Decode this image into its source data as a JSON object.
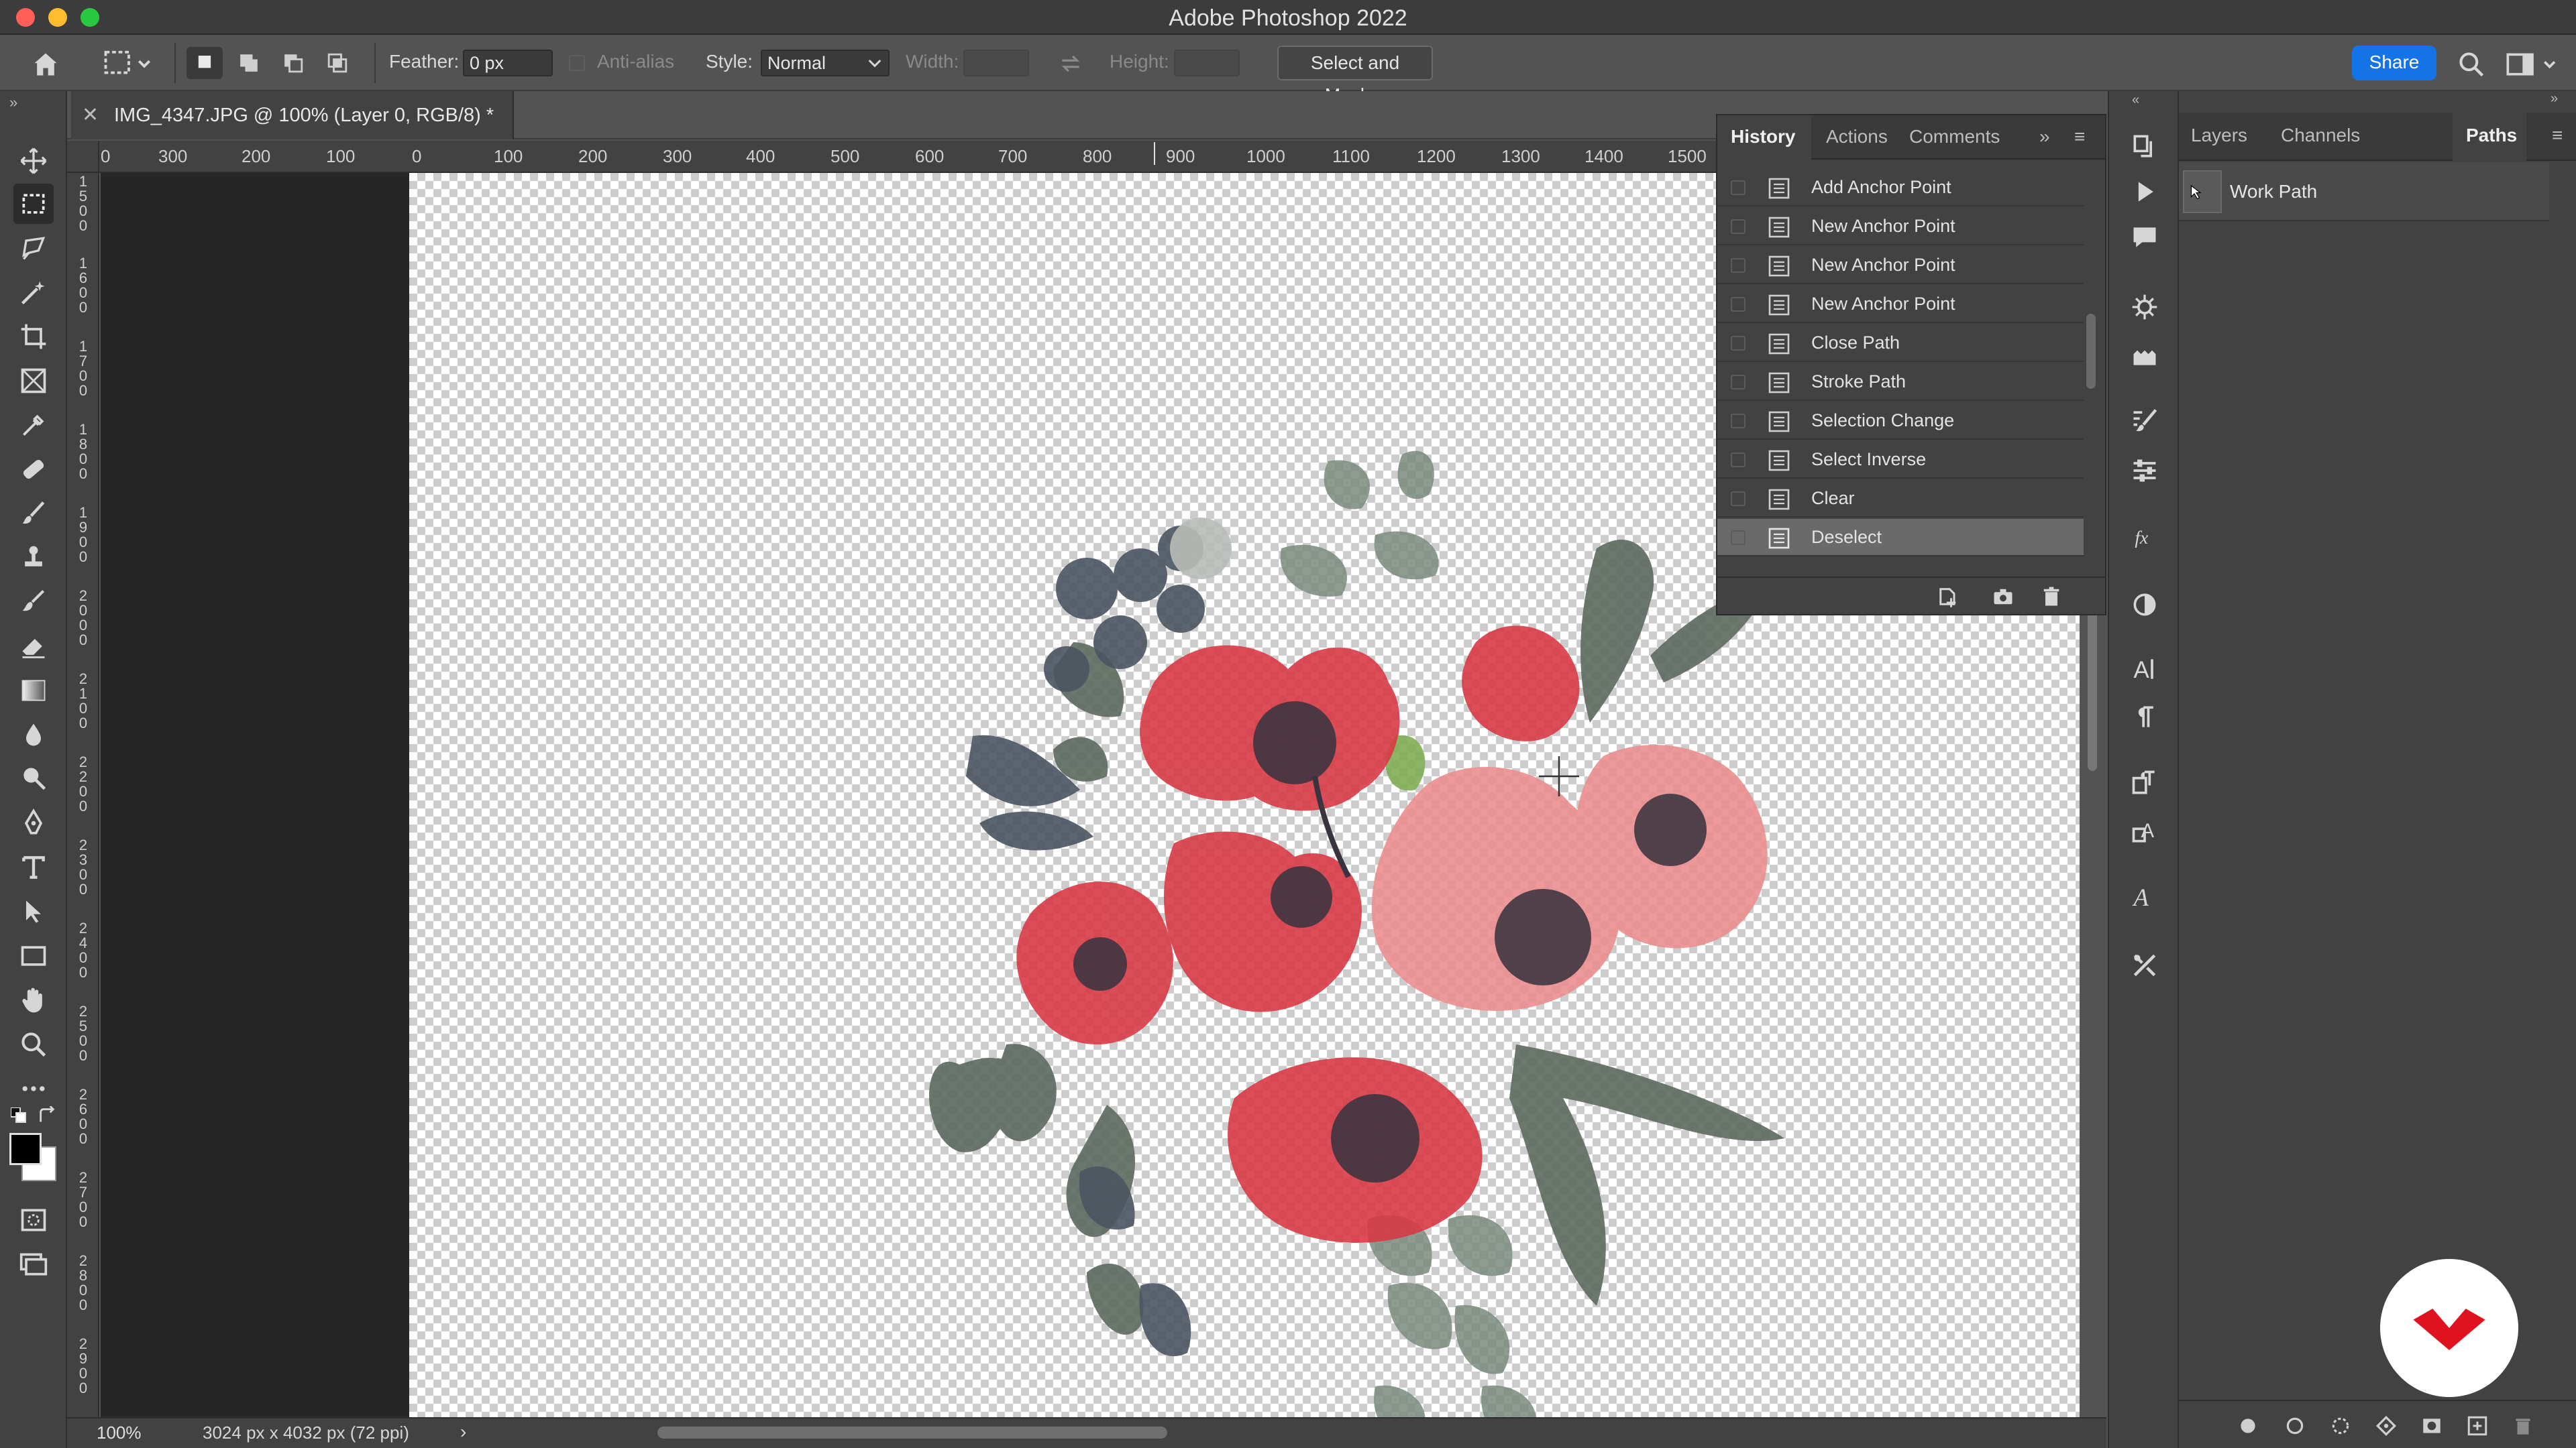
{
  "window": {
    "title": "Adobe Photoshop 2022",
    "traffic_lights": [
      "#ff5f57",
      "#febc2e",
      "#28c840"
    ]
  },
  "options_bar": {
    "feather_label": "Feather:",
    "feather_value": "0 px",
    "anti_alias_label": "Anti-alias",
    "style_label": "Style:",
    "style_value": "Normal",
    "width_label": "Width:",
    "height_label": "Height:",
    "select_mask_label": "Select and Mask...",
    "share_label": "Share"
  },
  "document": {
    "tab_title": "IMG_4347.JPG @ 100% (Layer 0, RGB/8) *",
    "zoom": "100%",
    "doc_info": "3024 px x 4032 px (72 ppi)",
    "h_ruler_labels": [
      "0",
      "300",
      "200",
      "100",
      "0",
      "100",
      "200",
      "300",
      "400",
      "500",
      "600",
      "700",
      "800",
      "900",
      "1000",
      "1100",
      "1200",
      "1300",
      "1400",
      "1500"
    ],
    "v_ruler_labels": [
      "1\n5\n0\n0",
      "1\n6\n0\n0",
      "1\n7\n0\n0",
      "1\n8\n0\n0",
      "1\n9\n0\n0",
      "2\n0\n0\n0",
      "2\n1\n0\n0",
      "2\n2\n0\n0",
      "2\n3\n0\n0",
      "2\n4\n0\n0",
      "2\n5\n0\n0",
      "2\n6\n0\n0",
      "2\n7\n0\n0",
      "2\n8\n0\n0",
      "2\n9\n0\n0"
    ]
  },
  "history_panel": {
    "tabs": [
      "History",
      "Actions",
      "Comments"
    ],
    "active_tab": "History",
    "items": [
      {
        "label": "Add Anchor Point"
      },
      {
        "label": "New Anchor Point"
      },
      {
        "label": "New Anchor Point"
      },
      {
        "label": "New Anchor Point"
      },
      {
        "label": "Close Path"
      },
      {
        "label": "Stroke Path"
      },
      {
        "label": "Selection Change"
      },
      {
        "label": "Select Inverse"
      },
      {
        "label": "Clear"
      },
      {
        "label": "Deselect"
      }
    ],
    "selected_index": 9
  },
  "right_panel": {
    "tabs": [
      "Layers",
      "Channels",
      "Paths"
    ],
    "active_tab": "Paths",
    "paths": [
      {
        "label": "Work Path"
      }
    ]
  },
  "colors": {
    "accent": "#1473e6",
    "brand_red": "#e0121f",
    "panel_bg": "#424242",
    "app_bg": "#535353"
  }
}
